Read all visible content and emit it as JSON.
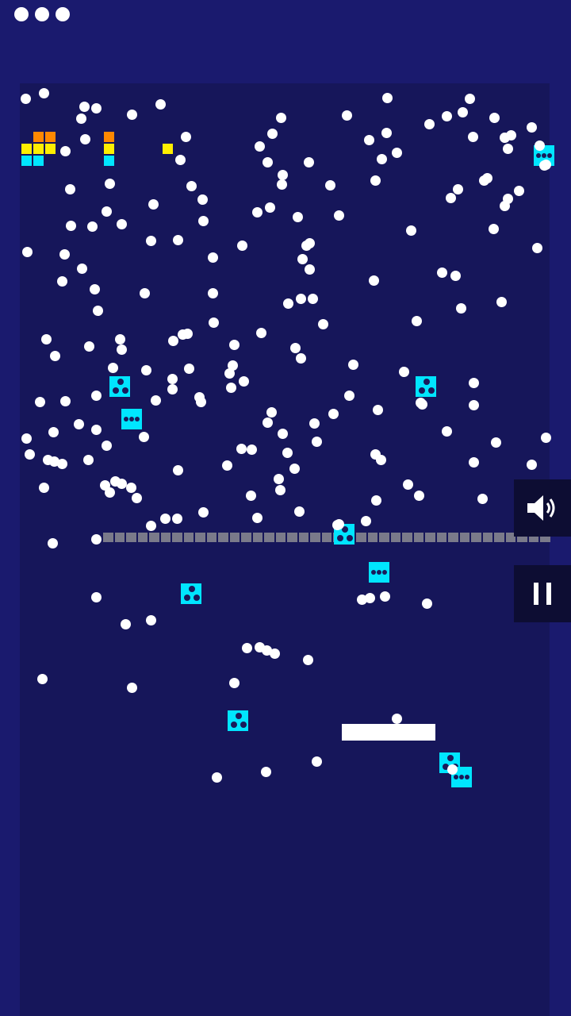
{
  "game": {
    "lives": 3,
    "ball_color": "#ffffff",
    "background_color": "#1a1a6e",
    "playfield_color": "#16165a",
    "powerup_color": "#00e5ff",
    "barrier_color": "#7a7a8a"
  },
  "controls": {
    "sound_icon": "speaker-on-icon",
    "pause_icon": "pause-icon"
  },
  "bricks": [
    {
      "color": "#ff8800"
    },
    {
      "color": "#ff8800"
    },
    {
      "color": "#ffee00"
    },
    {
      "color": "#ffee00"
    },
    {
      "color": "#ffee00"
    },
    {
      "color": "#00e5ff"
    },
    {
      "color": "#00e5ff"
    },
    {
      "color": "#ff8800"
    },
    {
      "color": "#ffee00"
    },
    {
      "color": "#00e5ff"
    },
    {
      "color": "#ffee00"
    }
  ],
  "powerups": [
    {
      "kind": "triangle-dots"
    },
    {
      "kind": "three-dots"
    },
    {
      "kind": "triangle-dots"
    },
    {
      "kind": "three-dots"
    },
    {
      "kind": "triangle-dots"
    },
    {
      "kind": "three-dots"
    },
    {
      "kind": "triangle-dots"
    },
    {
      "kind": "triangle-dots"
    },
    {
      "kind": "three-dots"
    },
    {
      "kind": "triangle-dots"
    },
    {
      "kind": "three-dots"
    }
  ]
}
